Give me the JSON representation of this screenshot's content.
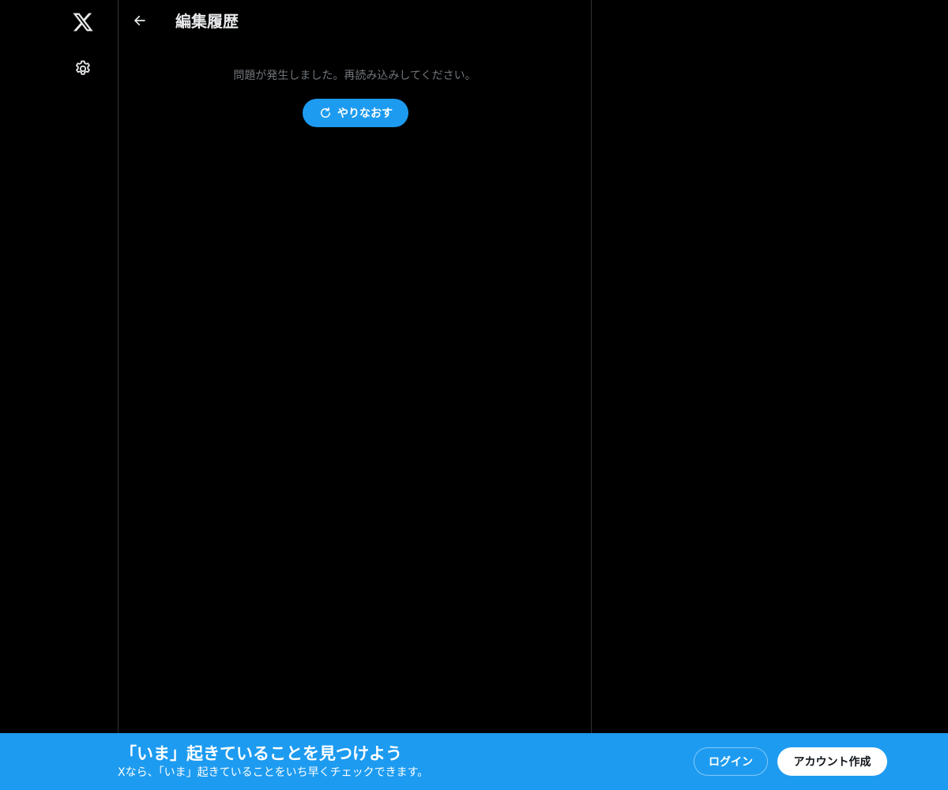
{
  "nav": {
    "logo_icon": "x-logo-icon",
    "settings_icon": "gear-icon"
  },
  "header": {
    "back_icon": "arrow-left-icon",
    "title": "編集履歴"
  },
  "main": {
    "error_message": "問題が発生しました。再読み込みしてください。",
    "retry_label": "やりなおす",
    "retry_icon": "refresh-icon"
  },
  "banner": {
    "title": "「いま」起きていることを見つけよう",
    "subtitle": "Xなら、「いま」起きていることをいち早くチェックできます。",
    "login_label": "ログイン",
    "signup_label": "アカウント作成"
  },
  "colors": {
    "background": "#000000",
    "accent": "#1d9bf0",
    "text_primary": "#e7e9ea",
    "text_secondary": "#71767b",
    "border": "#2f3336"
  }
}
